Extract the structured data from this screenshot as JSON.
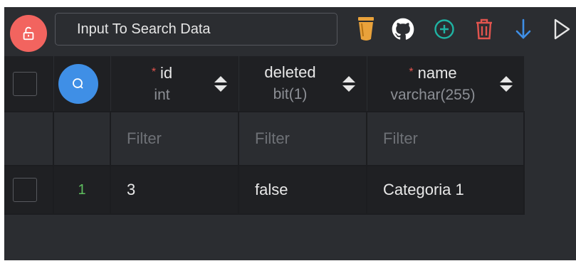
{
  "toolbar": {
    "search_placeholder": "Input To Search Data",
    "colors": {
      "lock": "#f2645f",
      "brush": "#e9a23b",
      "add": "#1fb3a3",
      "delete": "#e2544e",
      "download": "#3f8fe6"
    }
  },
  "table": {
    "columns": [
      {
        "name": "id",
        "type": "int",
        "required": true,
        "required_mark": "*"
      },
      {
        "name": "deleted",
        "type": "bit(1)",
        "required": false
      },
      {
        "name": "name",
        "type": "varchar(255)",
        "required": true,
        "required_mark": "*"
      }
    ],
    "filter_placeholder": "Filter",
    "rows": [
      {
        "row_number": "1",
        "cells": [
          "3",
          "false",
          "Categoria 1"
        ]
      }
    ]
  }
}
